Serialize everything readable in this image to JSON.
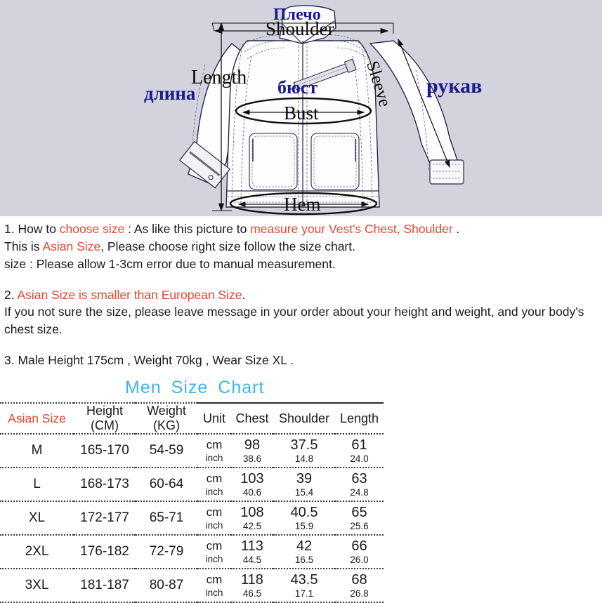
{
  "illustration": {
    "labels": {
      "shoulder_ru": "Плечо",
      "shoulder_en": "Shoulder",
      "length_en": "Length",
      "length_ru": "длина",
      "bust_ru": "бюст",
      "bust_en": "Bust",
      "sleeve_en": "Sleeve",
      "sleeve_ru": "рукав",
      "hem_en": "Hem"
    },
    "colors": {
      "background": "#d3d3de",
      "russian_label": "#1b1b8f",
      "english_label": "#0d0d0d"
    }
  },
  "description": {
    "line1": {
      "part1": "1. How to ",
      "highlight1": "choose size",
      "part2": " : As like this picture to ",
      "highlight2": "measure your Vest's Chest, Shoulder",
      "part3": " ."
    },
    "line2": {
      "part1": "This is ",
      "highlight1": "Asian Size",
      "part2": ", Please choose right size follow the size chart."
    },
    "line3": "size : Please allow 1-3cm error due to manual measurement.",
    "line4": {
      "part1": "2. ",
      "highlight1": "Asian Size is smaller than European Size",
      "part2": "."
    },
    "line5": "If you not sure the size, please leave message in your order about your height and weight, and your body's chest size.",
    "line6": "3. Male Height 175cm , Weight 70kg , Wear Size XL ."
  },
  "chart_title": {
    "word1": "Men",
    "word2": "Size",
    "word3": "Chart",
    "color": "#3fb5e8"
  },
  "table": {
    "accent_red": "#e5462f",
    "headers": {
      "asian_size": "Asian Size",
      "height_l1": "Height",
      "height_l2": "(CM)",
      "weight_l1": "Weight",
      "weight_l2": "(KG)",
      "unit": "Unit",
      "chest": "Chest",
      "shoulder": "Shoulder",
      "length": "Length"
    },
    "unit_labels": {
      "cm": "cm",
      "inch": "inch"
    },
    "rows": [
      {
        "size": "M",
        "height": "165-170",
        "weight": "54-59",
        "chest_cm": "98",
        "chest_inch": "38.6",
        "shoulder_cm": "37.5",
        "shoulder_inch": "14.8",
        "length_cm": "61",
        "length_inch": "24.0"
      },
      {
        "size": "L",
        "height": "168-173",
        "weight": "60-64",
        "chest_cm": "103",
        "chest_inch": "40.6",
        "shoulder_cm": "39",
        "shoulder_inch": "15.4",
        "length_cm": "63",
        "length_inch": "24.8"
      },
      {
        "size": "XL",
        "height": "172-177",
        "weight": "65-71",
        "chest_cm": "108",
        "chest_inch": "42.5",
        "shoulder_cm": "40.5",
        "shoulder_inch": "15.9",
        "length_cm": "65",
        "length_inch": "25.6"
      },
      {
        "size": "2XL",
        "height": "176-182",
        "weight": "72-79",
        "chest_cm": "113",
        "chest_inch": "44.5",
        "shoulder_cm": "42",
        "shoulder_inch": "16.5",
        "length_cm": "66",
        "length_inch": "26.0"
      },
      {
        "size": "3XL",
        "height": "181-187",
        "weight": "80-87",
        "chest_cm": "118",
        "chest_inch": "46.5",
        "shoulder_cm": "43.5",
        "shoulder_inch": "17.1",
        "length_cm": "68",
        "length_inch": "26.8"
      }
    ]
  }
}
